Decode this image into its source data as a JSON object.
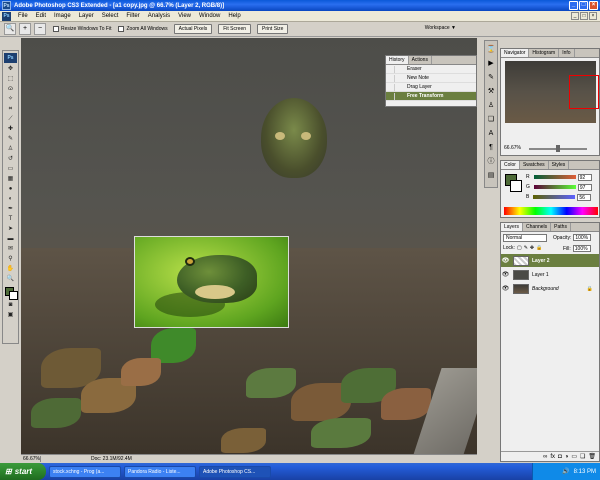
{
  "window": {
    "title": "Adobe Photoshop CS3 Extended - [a1 copy.jpg @ 66.7% (Layer 2, RGB/8)]"
  },
  "menu": {
    "app_badge": "Ps",
    "items": [
      "File",
      "Edit",
      "Image",
      "Layer",
      "Select",
      "Filter",
      "Analysis",
      "View",
      "Window",
      "Help"
    ]
  },
  "options": {
    "resize_windows": "Resize Windows To Fit",
    "zoom_all": "Zoom All Windows",
    "actual_pixels": "Actual Pixels",
    "fit_screen": "Fit Screen",
    "print_size": "Print Size",
    "workspace": "Workspace ▼"
  },
  "toolbox": {
    "logo": "Ps"
  },
  "history": {
    "tabs": [
      "History",
      "Actions"
    ],
    "items": [
      "Eraser",
      "New Note",
      "Drag Layer",
      "Free Transform"
    ]
  },
  "navigator": {
    "tabs": [
      "Navigator",
      "Histogram",
      "Info"
    ],
    "zoom": "66.67%"
  },
  "color": {
    "tabs": [
      "Color",
      "Swatches",
      "Styles"
    ],
    "channels": [
      {
        "label": "R",
        "value": "92",
        "color": "#e03030"
      },
      {
        "label": "G",
        "value": "97",
        "color": "#30a030"
      },
      {
        "label": "B",
        "value": "56",
        "color": "#3050e0"
      }
    ],
    "foreground": "#4d6a37"
  },
  "layers": {
    "tabs": [
      "Layers",
      "Channels",
      "Paths"
    ],
    "blend_mode": "Normal",
    "opacity_label": "Opacity:",
    "opacity_value": "100%",
    "lock_label": "Lock:",
    "fill_label": "Fill:",
    "fill_value": "100%",
    "items": [
      "Layer 2",
      "Layer 1",
      "Background"
    ]
  },
  "status": {
    "zoom": "66.67%",
    "doc": "Doc: 23.1M/92.4M"
  },
  "taskbar": {
    "start": "start",
    "tasks": [
      "stock.xchng - Prog (a...",
      "Pandora Radio - Liste...",
      "Adobe Photoshop CS..."
    ],
    "clock": "8:13 PM"
  }
}
